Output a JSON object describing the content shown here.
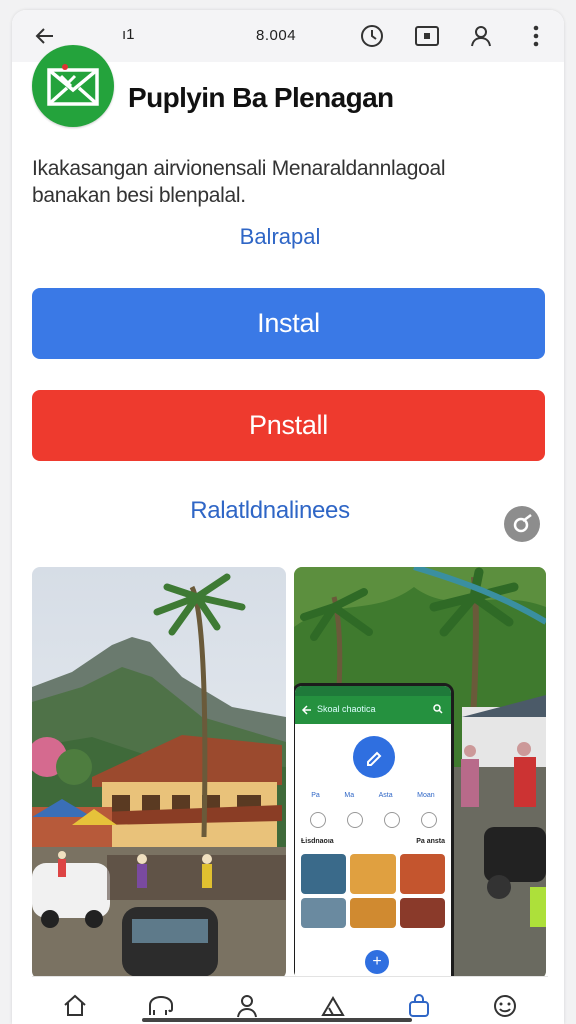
{
  "browser": {
    "lock_glyph": "🔒",
    "url_prefix": "ı1",
    "url_text": "8.004",
    "icons": [
      "back-arrow-icon",
      "clock-icon",
      "tab-icon",
      "profile-icon",
      "more-vert-icon"
    ]
  },
  "app": {
    "name": "Puplyin Ba Plenagan",
    "description": "Ikakasangan airvionensali Menaraldannlagoal banakan besi blenpalal.",
    "developer_link": "Balrapal",
    "logo_color": "#24a33c"
  },
  "buttons": {
    "install_label": "Instal",
    "uninstall_label": "Pnstall",
    "install_color": "#3a79e6",
    "uninstall_color": "#ee3a2e"
  },
  "related": {
    "label": "Ralatldnalinees",
    "share_icon": "share-icon"
  },
  "screenshots": {
    "inner_app": {
      "title": "Skoal chaotica",
      "section1": "Ƚisdnaoıa",
      "section2": "Pa ansta",
      "chips": [
        "Pa",
        "Ma",
        "Asta",
        "Moan"
      ]
    }
  },
  "bottom_nav": {
    "items": [
      "home-icon",
      "elephant-icon",
      "person-icon",
      "tent-icon",
      "bag-icon",
      "smiley-icon"
    ]
  },
  "colors": {
    "accent": "#2f66c6",
    "brand_green": "#24a33c"
  }
}
